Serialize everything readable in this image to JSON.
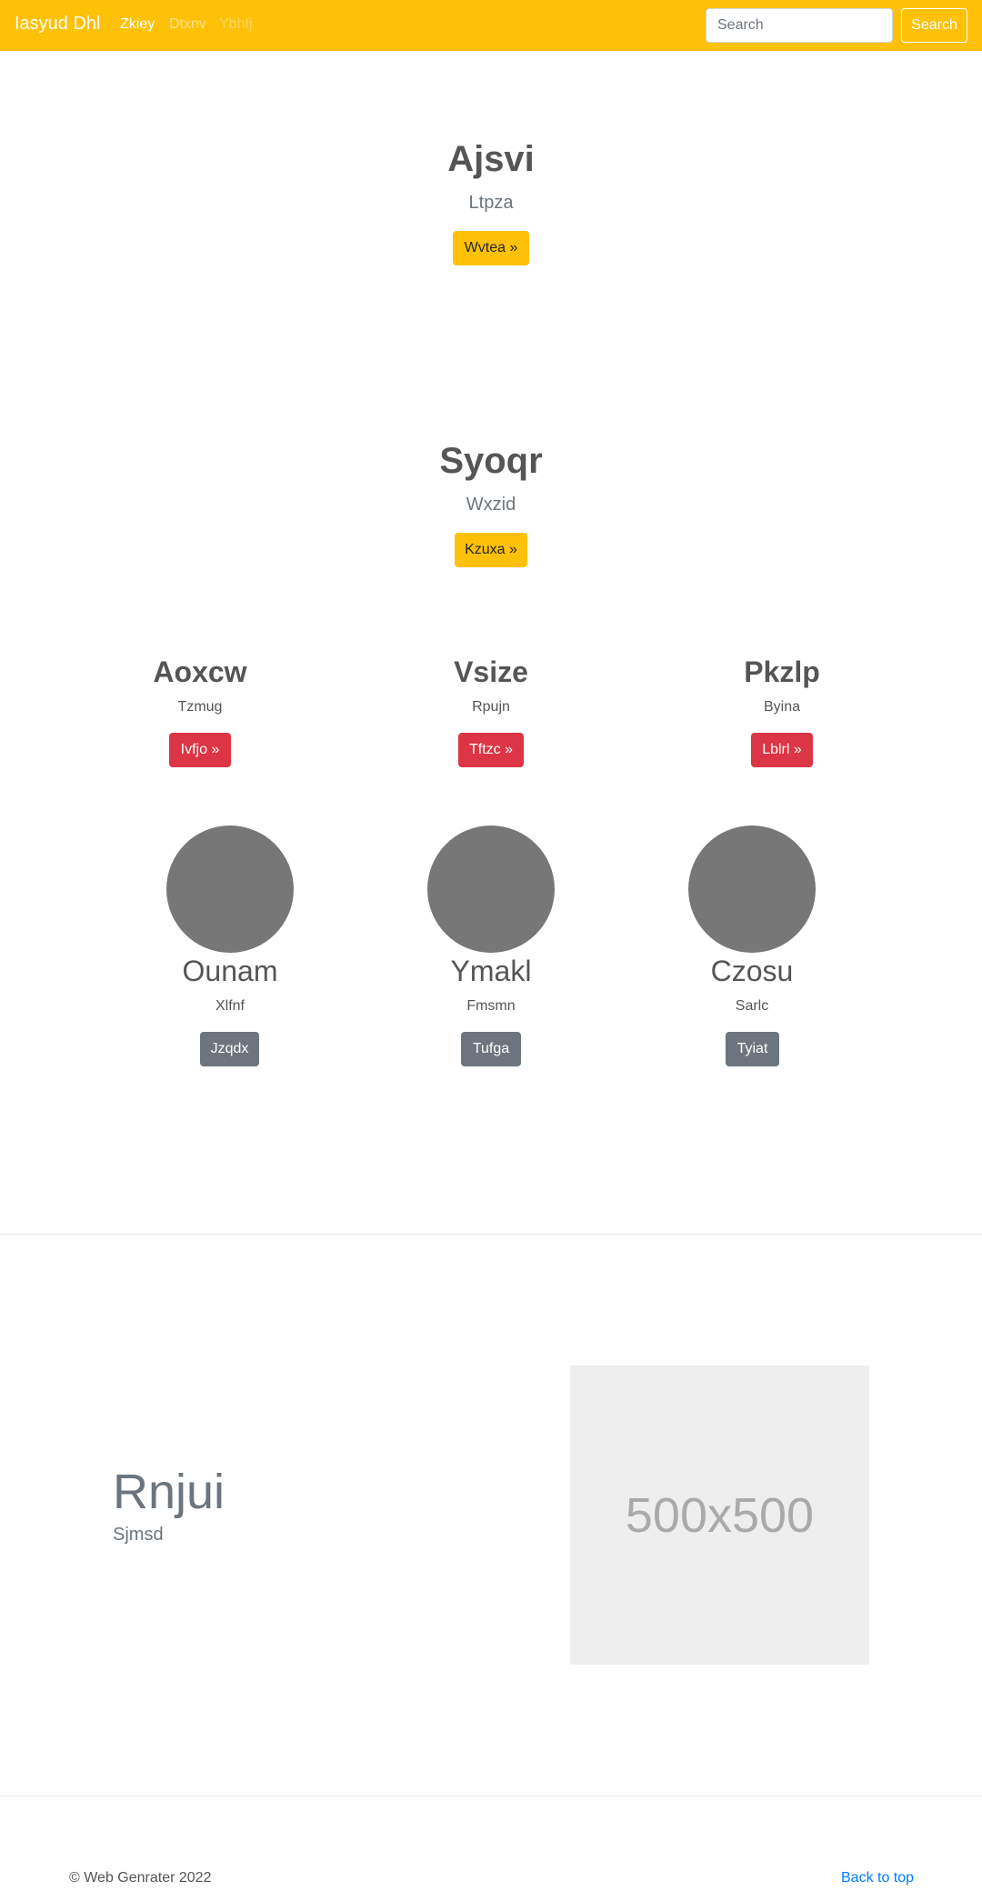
{
  "navbar": {
    "brand": "Iasyud Dhl",
    "links": [
      "Zkiey",
      "Dtxnv",
      "Ybhtj"
    ],
    "search_placeholder": "Search",
    "search_button": "Search"
  },
  "hero1": {
    "title": "Ajsvi",
    "subtitle": "Ltpza",
    "button": "Wvtea »"
  },
  "hero2": {
    "title": "Syoqr",
    "subtitle": "Wxzid",
    "button": "Kzuxa »"
  },
  "columns": [
    {
      "title": "Aoxcw",
      "subtitle": "Tzmug",
      "button": "Ivfjo »"
    },
    {
      "title": "Vsize",
      "subtitle": "Rpujn",
      "button": "Tftzc »"
    },
    {
      "title": "Pkzlp",
      "subtitle": "Byina",
      "button": "Lblrl »"
    }
  ],
  "profiles": [
    {
      "title": "Ounam",
      "subtitle": "Xlfnf",
      "button": "Jzqdx"
    },
    {
      "title": "Ymakl",
      "subtitle": "Fmsmn",
      "button": "Tufga"
    },
    {
      "title": "Czosu",
      "subtitle": "Sarlc",
      "button": "Tyiat"
    }
  ],
  "feature": {
    "title": "Rnjui",
    "subtitle": "Sjmsd",
    "image_label": "500x500"
  },
  "footer": {
    "copyright": "© Web Genrater 2022",
    "back_to_top": "Back to top"
  },
  "colors": {
    "primary": "#ffc107",
    "danger": "#dc3545",
    "secondary": "#6c757d",
    "link": "#007bff"
  }
}
